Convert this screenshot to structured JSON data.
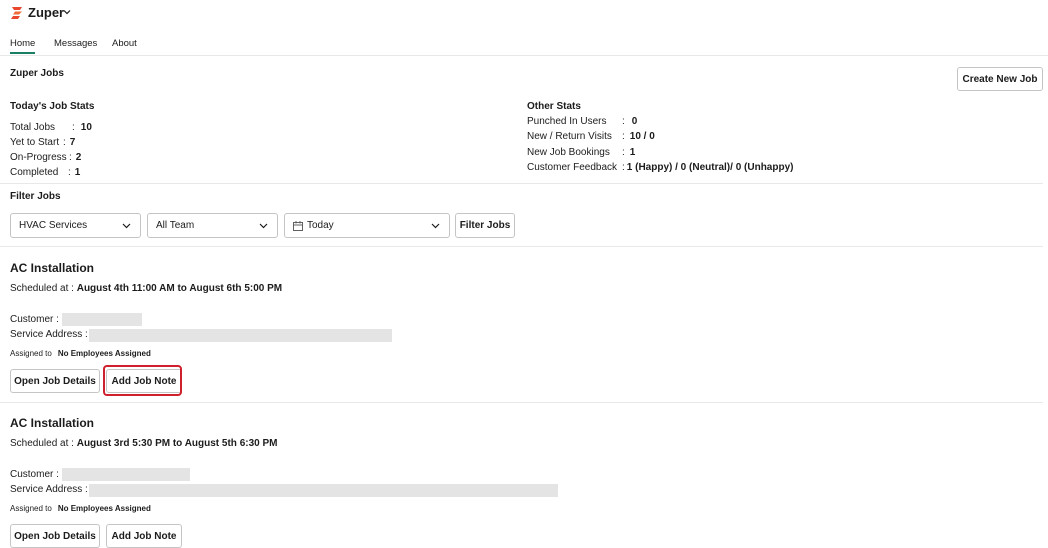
{
  "app": {
    "name": "Zuper"
  },
  "tabs": [
    {
      "label": "Home",
      "active": true
    },
    {
      "label": "Messages",
      "active": false
    },
    {
      "label": "About",
      "active": false
    }
  ],
  "main": {
    "title": "Zuper Jobs",
    "create_button": "Create New Job"
  },
  "todays_stats": {
    "title": "Today's Job Stats",
    "rows": [
      {
        "label": "Total Jobs",
        "colon": ":",
        "value": "10"
      },
      {
        "label": "Yet to Start",
        "colon": ":",
        "value": "7"
      },
      {
        "label": "On-Progress",
        "colon": ":",
        "value": "2"
      },
      {
        "label": "Completed",
        "colon": ":",
        "value": "1"
      }
    ]
  },
  "other_stats": {
    "title": "Other Stats",
    "rows": [
      {
        "label": "Punched In Users",
        "colon": ":",
        "value": "0"
      },
      {
        "label": "New / Return Visits",
        "colon": ":",
        "value": "10 / 0"
      },
      {
        "label": "New Job Bookings",
        "colon": ":",
        "value": "1"
      },
      {
        "label": "Customer Feedback",
        "colon": ":",
        "value": "1 (Happy) / 0 (Neutral)/ 0 (Unhappy)"
      }
    ]
  },
  "filter": {
    "title": "Filter Jobs",
    "service": "HVAC Services",
    "team": "All Team",
    "date": "Today",
    "button": "Filter Jobs"
  },
  "jobs": [
    {
      "title": "AC Installation",
      "scheduled_prefix": "Scheduled at :",
      "scheduled": "August 4th 11:00 AM to August 6th 5:00 PM",
      "customer_label": "Customer :",
      "address_label": "Service Address :",
      "assigned_label": "Assigned to",
      "assigned_value": "No Employees Assigned",
      "open_button": "Open Job Details",
      "note_button": "Add Job Note"
    },
    {
      "title": "AC Installation",
      "scheduled_prefix": "Scheduled at :",
      "scheduled": "August 3rd 5:30 PM to August 5th 6:30 PM",
      "customer_label": "Customer :",
      "address_label": "Service Address :",
      "assigned_label": "Assigned to",
      "assigned_value": "No Employees Assigned",
      "open_button": "Open Job Details",
      "note_button": "Add Job Note"
    }
  ],
  "colors": {
    "accent": "#1a7f64",
    "highlight": "#d0202e",
    "logo": "#e8472e"
  },
  "icons": {
    "logo": "zuper-logo-icon",
    "calendar": "calendar-icon",
    "chevron": "chevron-down-icon"
  }
}
